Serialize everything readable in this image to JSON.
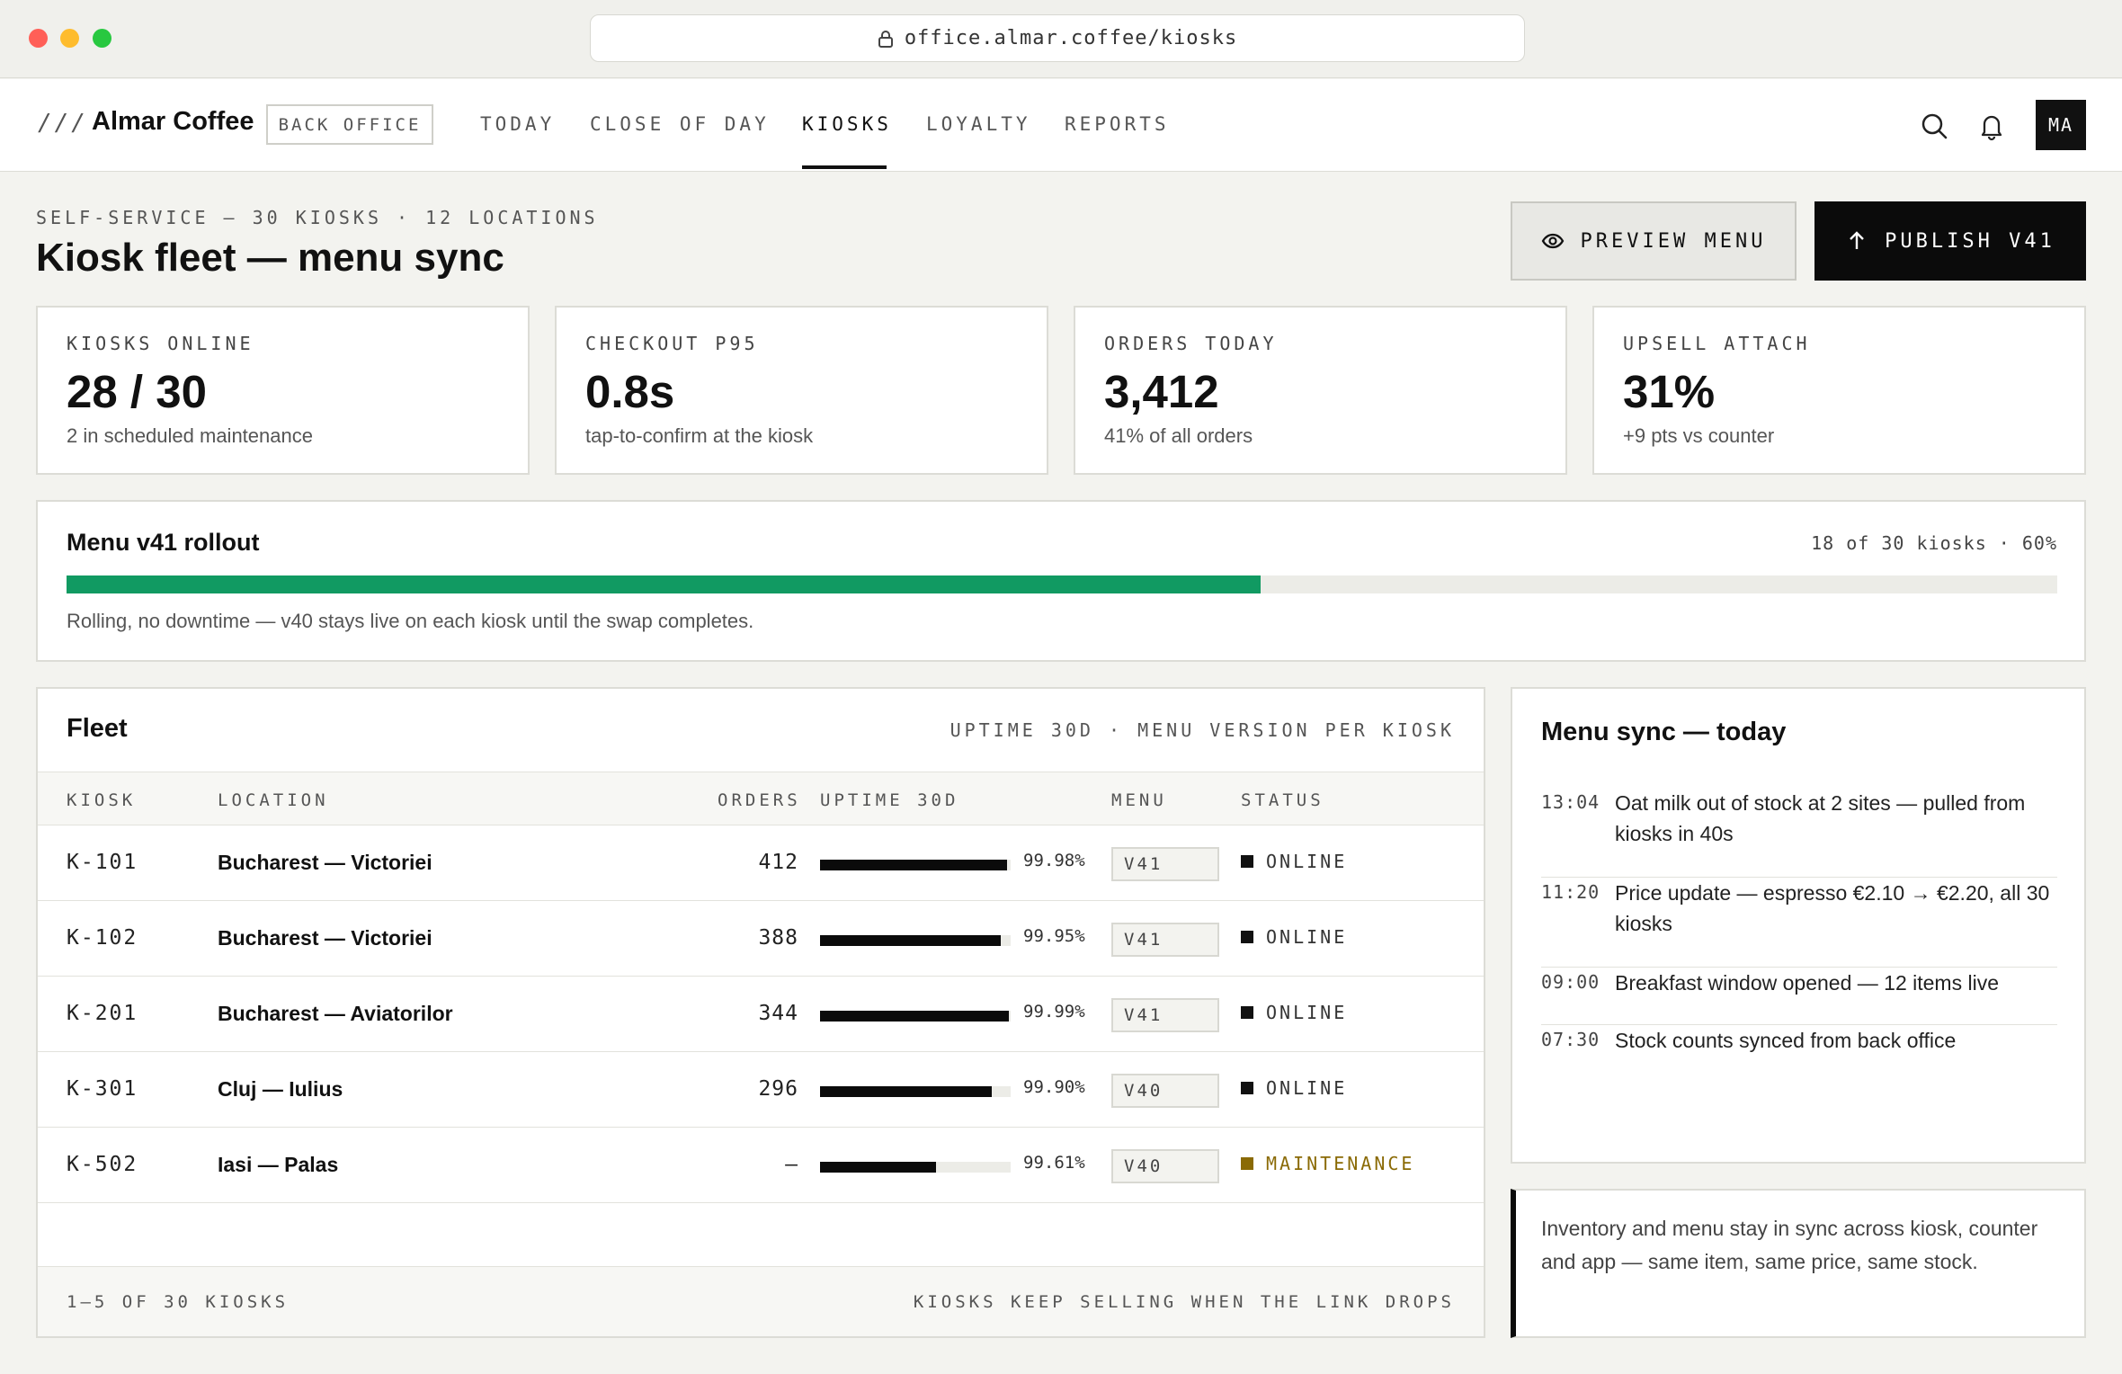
{
  "browser": {
    "url": "office.almar.coffee/kiosks"
  },
  "header": {
    "logo_mark": "///",
    "brand": "Almar Coffee",
    "back_office": "BACK OFFICE",
    "nav": [
      "TODAY",
      "CLOSE OF DAY",
      "KIOSKS",
      "LOYALTY",
      "REPORTS"
    ],
    "active_nav": "KIOSKS",
    "avatar": "MA"
  },
  "page": {
    "eyebrow": "SELF-SERVICE — 30 KIOSKS · 12 LOCATIONS",
    "title": "Kiosk fleet — menu sync",
    "preview_label": "PREVIEW MENU",
    "publish_label": "PUBLISH V41"
  },
  "stats": [
    {
      "label": "KIOSKS ONLINE",
      "value": "28 / 30",
      "sub": "2 in scheduled maintenance"
    },
    {
      "label": "CHECKOUT P95",
      "value": "0.8s",
      "sub": "tap-to-confirm at the kiosk"
    },
    {
      "label": "ORDERS TODAY",
      "value": "3,412",
      "sub": "41% of all orders"
    },
    {
      "label": "UPSELL ATTACH",
      "value": "31%",
      "sub": "+9 pts vs counter"
    }
  ],
  "rollout": {
    "title": "Menu v41 rollout",
    "meta": "18 of 30 kiosks · 60%",
    "progress": 0.6,
    "note": "Rolling, no downtime — v40 stays live on each kiosk until the swap completes.",
    "color": "#119a62"
  },
  "fleet": {
    "title": "Fleet",
    "meta": "UPTIME 30D · MENU VERSION PER KIOSK",
    "columns": [
      "KIOSK",
      "LOCATION",
      "ORDERS",
      "UPTIME 30D",
      "MENU",
      "STATUS"
    ],
    "rows": [
      {
        "kiosk": "K-101",
        "location": "Bucharest — Victoriei",
        "orders": "412",
        "uptime": "99.98%",
        "uptime_fraction": 0.9998,
        "menu": "V41",
        "status": "ONLINE",
        "warn": false
      },
      {
        "kiosk": "K-102",
        "location": "Bucharest — Victoriei",
        "orders": "388",
        "uptime": "99.95%",
        "uptime_fraction": 0.9995,
        "menu": "V41",
        "status": "ONLINE",
        "warn": false
      },
      {
        "kiosk": "K-201",
        "location": "Bucharest — Aviatorilor",
        "orders": "344",
        "uptime": "99.99%",
        "uptime_fraction": 0.9999,
        "menu": "V41",
        "status": "ONLINE",
        "warn": false
      },
      {
        "kiosk": "K-301",
        "location": "Cluj — Iulius",
        "orders": "296",
        "uptime": "99.90%",
        "uptime_fraction": 0.999,
        "menu": "V40",
        "status": "ONLINE",
        "warn": false
      },
      {
        "kiosk": "K-502",
        "location": "Iasi — Palas",
        "orders": "—",
        "uptime": "99.61%",
        "uptime_fraction": 0.9961,
        "menu": "V40",
        "status": "MAINTENANCE",
        "warn": true
      }
    ],
    "footer_left": "1–5 OF 30 KIOSKS",
    "footer_right": "KIOSKS KEEP SELLING WHEN THE LINK DROPS"
  },
  "sync": {
    "title": "Menu sync — today",
    "events": [
      {
        "time": "13:04",
        "text": "Oat milk out of stock at 2 sites — pulled from kiosks in 40s"
      },
      {
        "time": "11:20",
        "text": "Price update — espresso €2.10 → €2.20, all 30 kiosks"
      },
      {
        "time": "09:00",
        "text": "Breakfast window opened — 12 items live"
      },
      {
        "time": "07:30",
        "text": "Stock counts synced from back office"
      }
    ]
  },
  "callout": "Inventory and menu stay in sync across kiosk, counter and app — same item, same price, same stock."
}
